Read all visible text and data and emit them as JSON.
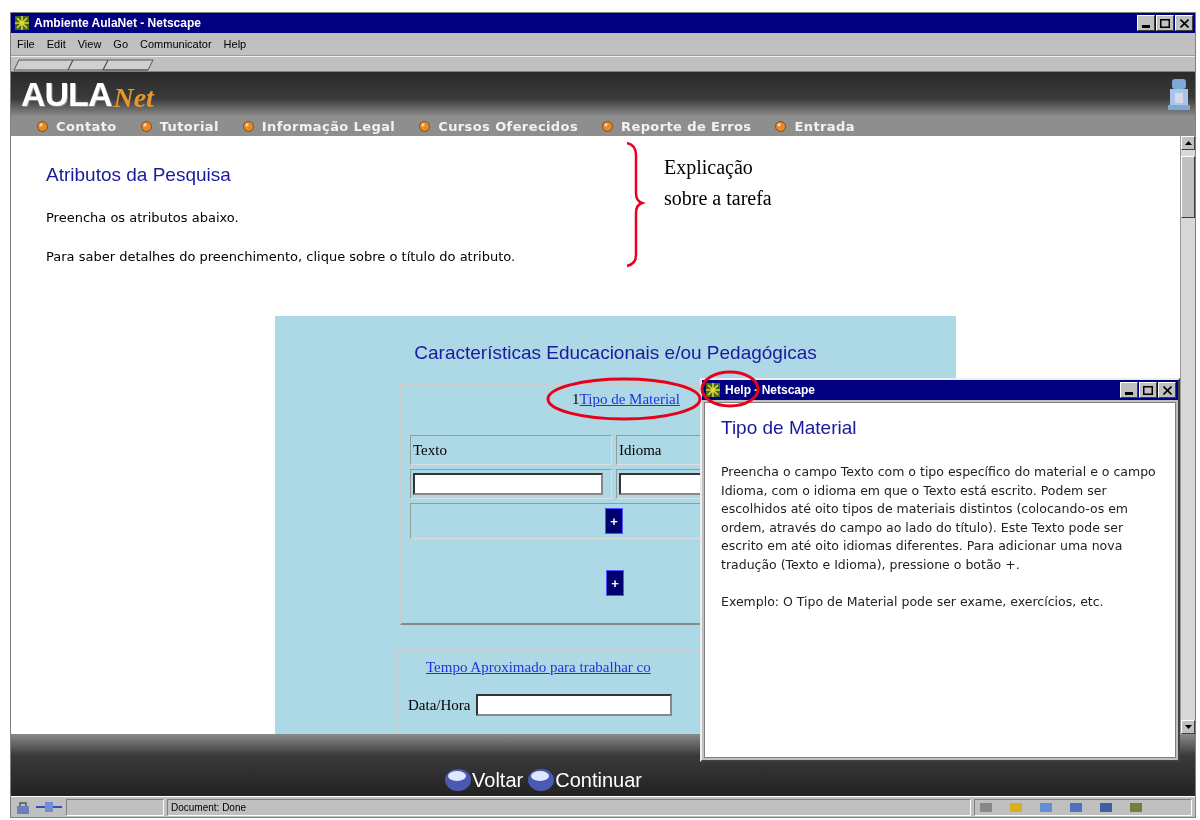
{
  "window": {
    "title": "Ambiente AulaNet - Netscape"
  },
  "menu": [
    "File",
    "Edit",
    "View",
    "Go",
    "Communicator",
    "Help"
  ],
  "banner": {
    "logo": [
      "AULA",
      "Net"
    ],
    "nav": [
      "Contato",
      "Tutorial",
      "Informação Legal",
      "Cursos Oferecidos",
      "Reporte de Erros",
      "Entrada"
    ]
  },
  "page": {
    "heading": "Atributos da Pesquisa",
    "paragraphs": [
      "Preencha os atributos abaixo.",
      "Para saber detalhes do preenchimento, clique sobre o título do atributo."
    ],
    "form": {
      "title": "Características Educacionais e/ou Pedagógicas",
      "material_section": {
        "order": "1",
        "link": "Tipo de Material",
        "columns": [
          "Texto",
          "Idioma"
        ],
        "buttons": [
          "+",
          "+"
        ]
      },
      "time_section": {
        "link": "Tempo Aproximado para trabalhar co",
        "field_label": "Data/Hora"
      }
    }
  },
  "annotation": {
    "text": "Explicação sobre a tarefa"
  },
  "footer": {
    "buttons": [
      "Voltar",
      "Continuar"
    ]
  },
  "status_bar": {
    "text": "Document: Done"
  },
  "help_window": {
    "title": "Help - Netscape",
    "heading": "Tipo de Material",
    "paragraphs": [
      "Preencha o campo Texto com o tipo específico do material e o campo Idioma, com o idioma em que o Texto está escrito. Podem ser escolhidos até oito tipos de materiais distintos (colocando-os em ordem, através do campo ao lado do título). Este Texto pode ser escrito em até oito idiomas diferentes. Para adicionar uma nova tradução (Texto e Idioma), pressione o botão +.",
      "Exemplo: O Tipo de Material pode ser exame, exercícios, etc."
    ]
  }
}
